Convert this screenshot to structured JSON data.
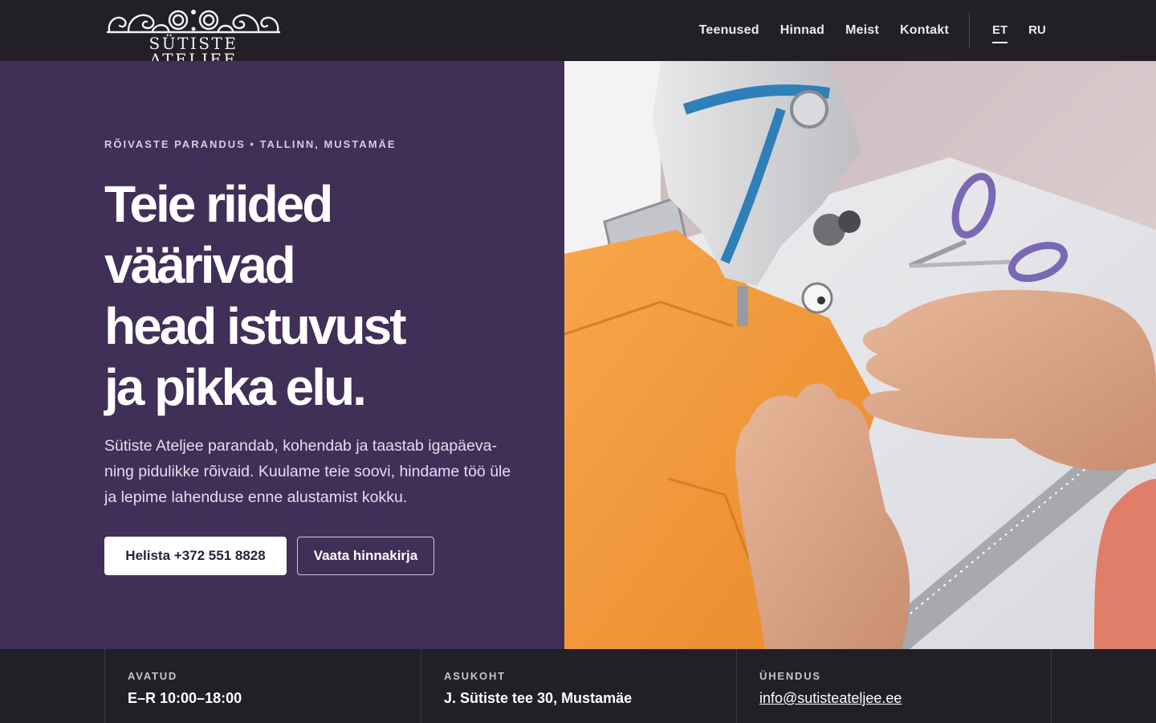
{
  "brand": {
    "name": "SÜTISTE ATELJEE"
  },
  "nav": {
    "items": [
      "Teenused",
      "Hinnad",
      "Meist",
      "Kontakt"
    ]
  },
  "lang": {
    "items": [
      "ET",
      "RU"
    ],
    "active": "ET"
  },
  "hero": {
    "eyebrow": "RÕIVASTE PARANDUS • TALLINN, MUSTAMÄE",
    "headline_lines": [
      "Teie riided",
      "väärivad",
      "head istuvust",
      "ja pikka elu."
    ],
    "lead": "Sütiste Ateljee parandab, kohendab ja taastab igapäeva- ning pidulikke rõivaid. Kuulame teie soovi, hindame töö üle ja lepime lahenduse enne alustamist kokku.",
    "primary_cta": "Helista +372 551 8828",
    "secondary_cta": "Vaata hinnakirja"
  },
  "info": {
    "hours": {
      "label": "AVATUD",
      "value": "E–R 10:00–18:00"
    },
    "location": {
      "label": "ASUKOHT",
      "value": "J. Sütiste tee 30, Mustamäe"
    },
    "contact": {
      "label": "ÜHENDUS",
      "value": "info@sutisteateljee.ee"
    }
  },
  "colors": {
    "hero_bg": "#402f57",
    "header_bg": "#221f27",
    "fabric": "#f29a3a",
    "scissors": "#7b68b4"
  }
}
